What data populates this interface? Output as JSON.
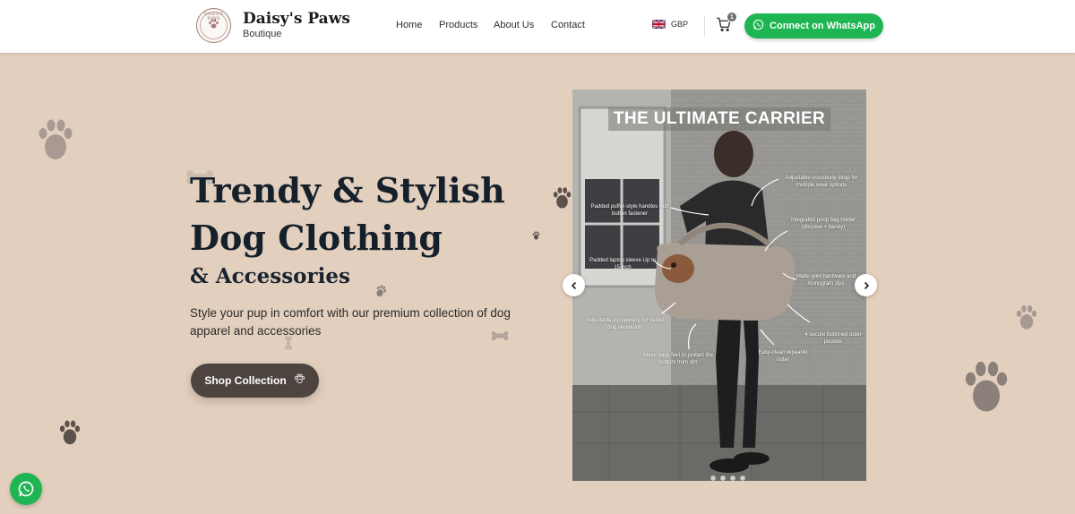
{
  "header": {
    "brand_name": "Daisy's Paws",
    "brand_sub": "Boutique",
    "logo_ring_text": "DAISY'S PAWS",
    "nav": [
      {
        "label": "Home"
      },
      {
        "label": "Products"
      },
      {
        "label": "About Us"
      },
      {
        "label": "Contact"
      }
    ],
    "currency": "GBP",
    "cart_count": "1",
    "whatsapp_label": "Connect on WhatsApp"
  },
  "hero": {
    "title_line1": "Trendy & Stylish",
    "title_line2": "Dog Clothing",
    "title_line3": "& Accessories",
    "description": "Style your pup in comfort with our premium collection of dog apparel and accessories",
    "cta_label": "Shop Collection"
  },
  "carousel": {
    "slide_title": "THE ULTIMATE CARRIER",
    "annotations": [
      "Adjustable crossbody strap for multiple wear options",
      "Padded puffer-style handles with button fastener",
      "Integrated poop bag holder (discreet + handy)",
      "Padded laptop sleeve Up to 15 inch",
      "Matte gold hardware and monogram zips",
      "Adjustable zip opening for varied dog viewpoints",
      "4 secure buttoned outer pockets",
      "Metal base feet to protect the bottom from dirt",
      "Easy-clean wipeable outer"
    ],
    "prev_icon": "chevron-left-icon",
    "next_icon": "chevron-right-icon",
    "slide_count": 4
  },
  "colors": {
    "background": "#e2cfbd",
    "whatsapp_green": "#1fb553",
    "cta_brown": "#4e443f",
    "heading": "#15202b"
  }
}
